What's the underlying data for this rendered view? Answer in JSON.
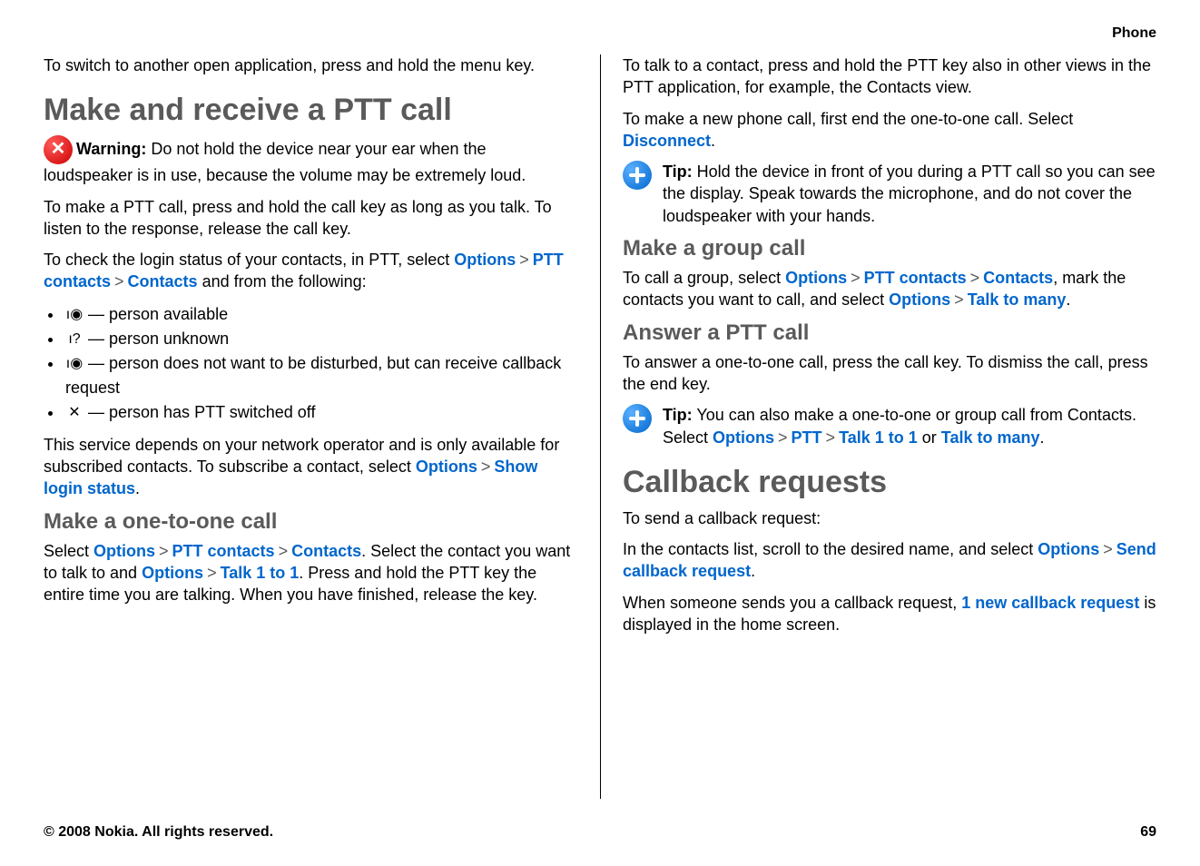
{
  "breadcrumb": "Phone",
  "left": {
    "p_intro": "To switch to another open application, press and hold the menu key.",
    "h1": "Make and receive a PTT call",
    "warning_label": "Warning:",
    "warning_text": "  Do not hold the device near your ear when the loudspeaker is in use, because the volume may be extremely loud.",
    "p2": "To make a PTT call, press and hold the call key as long as you talk. To listen to the response, release the call key.",
    "p3_a": "To check the login status of your contacts, in PTT, select ",
    "p3_options": "Options",
    "p3_ptt": "PTT contacts",
    "p3_contacts": "Contacts",
    "p3_b": " and from the following:",
    "li1": " — person available",
    "li2": " — person unknown",
    "li3": " — person does not want to be disturbed, but can receive callback request",
    "li4": " — person has PTT switched off",
    "p4_a": "This service depends on your network operator and is only available for subscribed contacts. To subscribe a contact, select ",
    "p4_options": "Options",
    "p4_show": "Show login status",
    "h2": "Make a one-to-one call",
    "p5_a": "Select ",
    "p5_options": "Options",
    "p5_ptt": "PTT contacts",
    "p5_contacts": "Contacts",
    "p5_b": ". Select the contact you want to talk to and ",
    "p5_options2": "Options",
    "p5_talk": "Talk 1 to 1",
    "p5_c": ". Press and hold the PTT key the entire time you are talking. When you have finished, release the key."
  },
  "right": {
    "p1": "To talk to a contact, press and hold the PTT key also in other views in the PTT application, for example, the Contacts view.",
    "p2_a": "To make a new phone call, first end the one-to-one call. Select ",
    "p2_disconnect": "Disconnect",
    "tip1_label": "Tip:",
    "tip1_text": " Hold the device in front of you during a PTT call so you can see the display. Speak towards the microphone, and do not cover the loudspeaker with your hands.",
    "h2a": "Make a group call",
    "p3_a": "To call a group, select ",
    "p3_options": "Options",
    "p3_ptt": "PTT contacts",
    "p3_contacts": "Contacts",
    "p3_b": ", mark the contacts you want to call, and select ",
    "p3_options2": "Options",
    "p3_talk": "Talk to many",
    "h2b": "Answer a PTT call",
    "p4": "To answer a one-to-one call, press the call key. To dismiss the call, press the end key.",
    "tip2_label": "Tip:",
    "tip2_a": " You can also make a one-to-one or group call from Contacts. Select ",
    "tip2_options": "Options",
    "tip2_ptt": "PTT",
    "tip2_talk1": "Talk 1 to 1",
    "tip2_or": " or ",
    "tip2_talkmany": "Talk to many",
    "h1b": "Callback requests",
    "p5": "To send a callback request:",
    "p6_a": "In the contacts list, scroll to the desired name, and select ",
    "p6_options": "Options",
    "p6_send": "Send callback request",
    "p7_a": "When someone sends you a callback request, ",
    "p7_b": "1 new callback request",
    "p7_c": " is displayed in the home screen."
  },
  "footer": {
    "copyright": "© 2008 Nokia. All rights reserved.",
    "page": "69"
  }
}
